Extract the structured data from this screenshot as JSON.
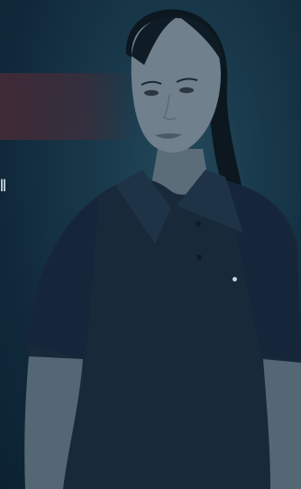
{
  "hero": {
    "edge_text": "ll",
    "shirt_logo_text": "",
    "colors": {
      "background": "#13293a",
      "shirt": "#18293a",
      "skin": "#6d7d89",
      "hair": "#0c1720",
      "band": "#6b2c35"
    }
  }
}
